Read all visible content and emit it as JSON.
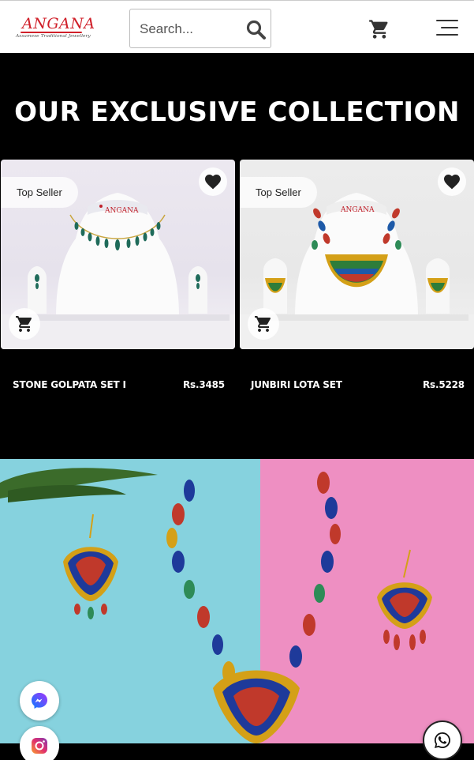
{
  "header": {
    "logo_name": "ANGANA",
    "logo_tagline": "Assamese Traditional Jewellery",
    "search_placeholder": "Search..."
  },
  "collection": {
    "title": "OUR EXCLUSIVE COLLECTION",
    "products": [
      {
        "name": "STONE GOLPATA SET I",
        "price": "Rs.3485",
        "badge": "Top Seller"
      },
      {
        "name": "JUNBIRI LOTA SET",
        "price": "Rs.5228",
        "badge": "Top Seller"
      }
    ]
  },
  "icons": {
    "search": "search-icon",
    "cart": "cart-icon",
    "menu": "hamburger-menu-icon",
    "heart": "heart-icon",
    "messenger": "messenger-icon",
    "instagram": "instagram-icon",
    "whatsapp": "whatsapp-icon"
  },
  "colors": {
    "brand_red": "#d0202a",
    "page_bg": "#000000",
    "banner_left": "#86d2de",
    "banner_right": "#ee8fc2"
  }
}
